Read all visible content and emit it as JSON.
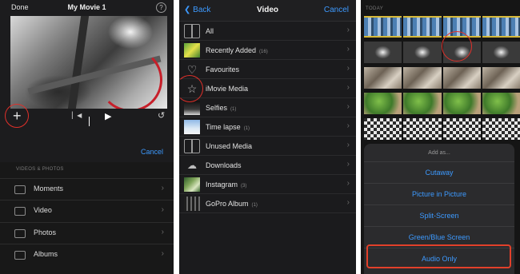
{
  "panel1": {
    "done_label": "Done",
    "title": "My Movie 1",
    "help_icon": "?",
    "cancel_label": "Cancel",
    "section_header": "VIDEOS & PHOTOS",
    "items": [
      {
        "label": "Moments",
        "icon": "moments-icon"
      },
      {
        "label": "Video",
        "icon": "video-icon"
      },
      {
        "label": "Photos",
        "icon": "photos-icon"
      },
      {
        "label": "Albums",
        "icon": "albums-icon"
      }
    ]
  },
  "panel2": {
    "back_label": "Back",
    "title": "Video",
    "cancel_label": "Cancel",
    "rows": [
      {
        "label": "All",
        "count": ""
      },
      {
        "label": "Recently Added",
        "count": "(16)"
      },
      {
        "label": "Favourites",
        "count": ""
      },
      {
        "label": "iMovie Media",
        "count": ""
      },
      {
        "label": "Selfies",
        "count": "(1)"
      },
      {
        "label": "Time lapse",
        "count": "(1)"
      },
      {
        "label": "Unused Media",
        "count": ""
      },
      {
        "label": "Downloads",
        "count": ""
      },
      {
        "label": "Instagram",
        "count": "(3)"
      },
      {
        "label": "GoPro Album",
        "count": "(1)"
      }
    ]
  },
  "panel3": {
    "section_header": "TODAY",
    "sheet_title": "Add as...",
    "options": [
      "Cutaway",
      "Picture in Picture",
      "Split-Screen",
      "Green/Blue Screen",
      "Audio Only"
    ]
  },
  "colors": {
    "accent_blue": "#3d9aff",
    "highlight_red": "#e2402a"
  }
}
